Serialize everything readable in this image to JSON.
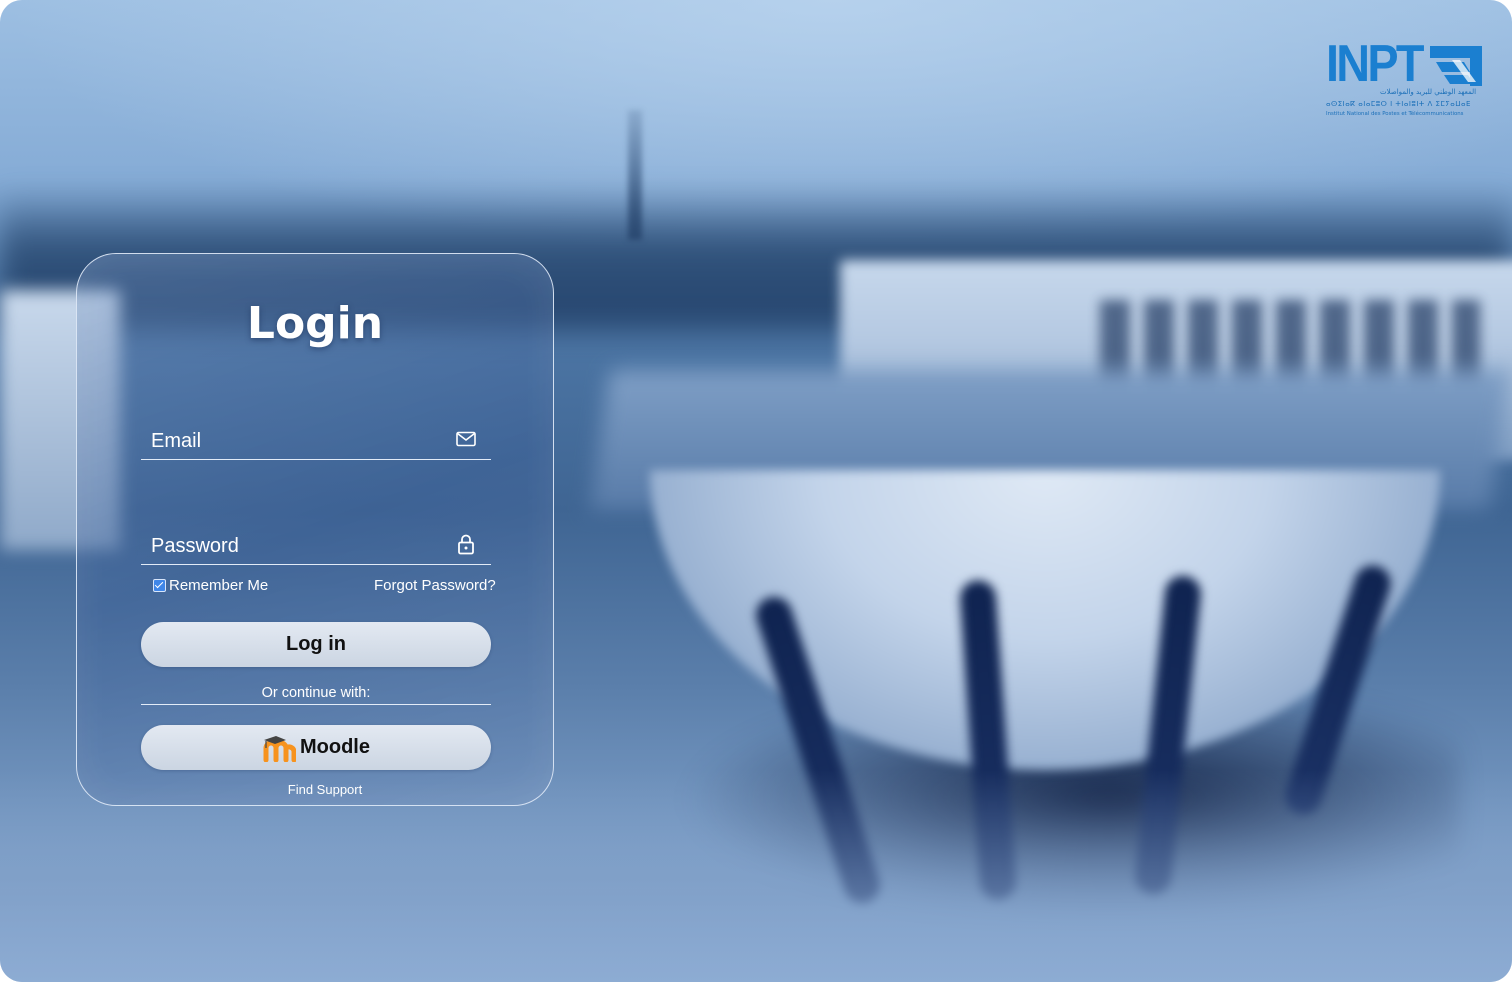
{
  "brand": {
    "logo_text": "INPT",
    "logo_line_arabic": "المعهد الوطني للبريد والمواصلات",
    "logo_line_tifinagh": "ⴰⵙⵉⵏⴰⴽ ⴰⵏⴰⵎⵓⵔ ⵏ ⵜⵏⴰⵏⵓⵏⵜ ⴷ ⵉⵎⵢⴰⵡⴰⴹ",
    "logo_line_french": "Institut National des Postes et Télécommunications",
    "color": "#1b7fd0"
  },
  "login": {
    "title": "Login",
    "email_placeholder": "Email",
    "email_icon": "envelope-icon",
    "password_placeholder": "Password",
    "password_icon": "lock-icon",
    "remember_label": "Remember Me",
    "remember_checked": true,
    "forgot_label": "Forgot Password?",
    "login_button": "Log in",
    "divider_text": "Or continue with:",
    "moodle_button": "Moodle",
    "moodle_icon": "moodle-logo-icon",
    "support_link": "Find Support"
  }
}
